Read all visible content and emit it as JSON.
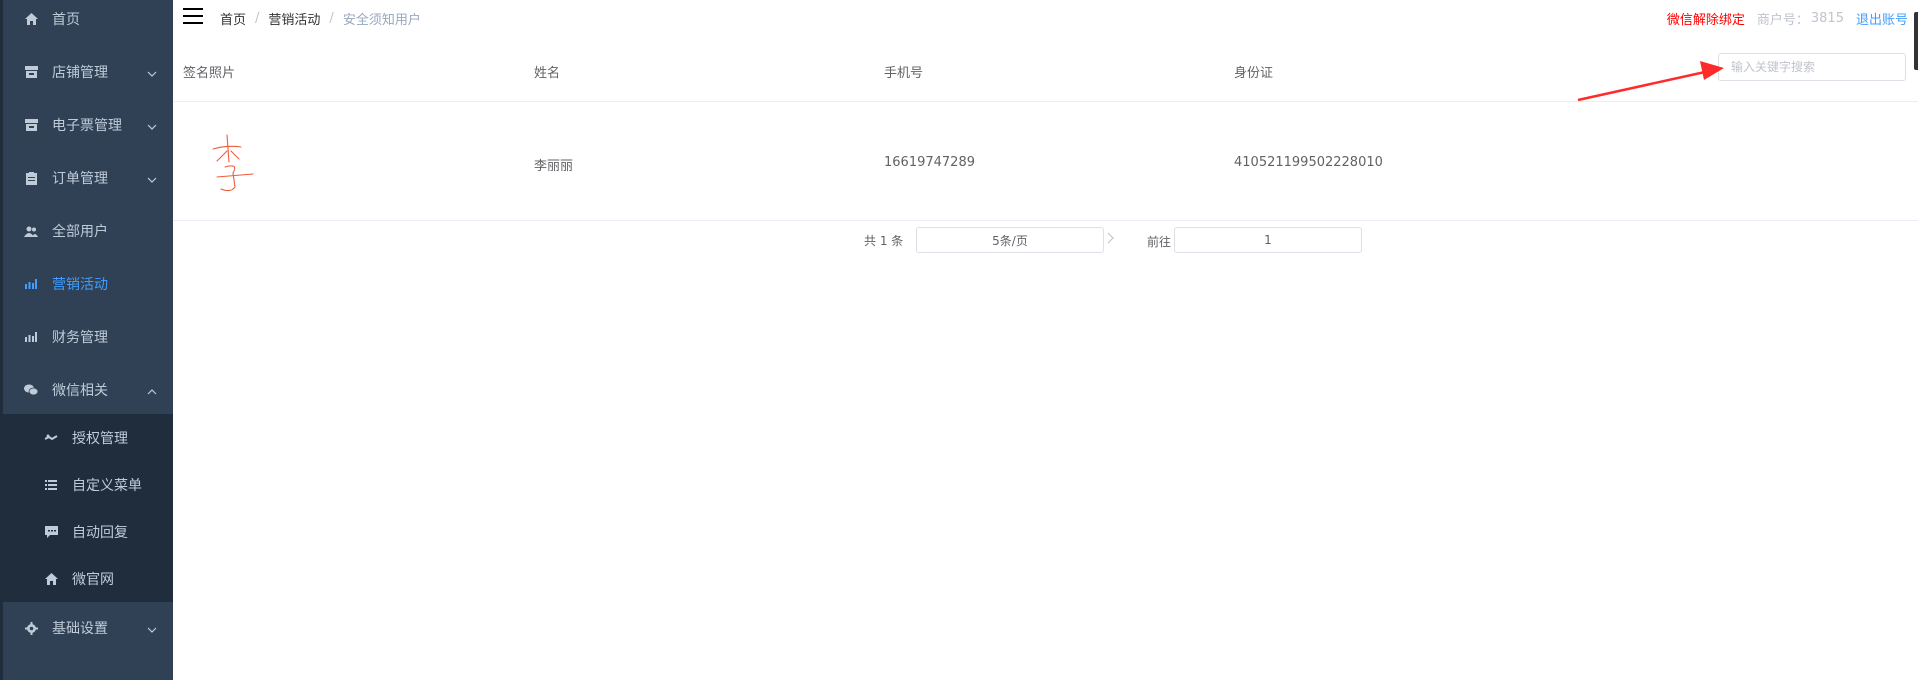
{
  "sidebar": {
    "items": [
      {
        "label": "首页",
        "icon": "home-icon"
      },
      {
        "label": "店铺管理",
        "icon": "store-icon"
      },
      {
        "label": "电子票管理",
        "icon": "ticket-icon"
      },
      {
        "label": "订单管理",
        "icon": "clipboard-icon"
      },
      {
        "label": "全部用户",
        "icon": "users-icon"
      },
      {
        "label": "营销活动",
        "icon": "bar-chart-icon",
        "active": true
      },
      {
        "label": "财务管理",
        "icon": "bar-chart-icon"
      },
      {
        "label": "微信相关",
        "icon": "wechat-icon",
        "expanded": true
      },
      {
        "label": "基础设置",
        "icon": "gear-icon"
      }
    ],
    "wechat_submenu": [
      {
        "label": "授权管理",
        "icon": "link-icon"
      },
      {
        "label": "自定义菜单",
        "icon": "list-icon"
      },
      {
        "label": "自动回复",
        "icon": "chat-icon"
      },
      {
        "label": "微官网",
        "icon": "home-icon"
      }
    ],
    "colors": {
      "background": "#304156",
      "submenu_background": "#1f2d3d",
      "text": "#bfcbd9",
      "active": "#409eff"
    }
  },
  "header": {
    "breadcrumb": [
      "首页",
      "营销活动",
      "安全须知用户"
    ],
    "breadcrumb_separator": "/",
    "unbind_wechat": "微信解除绑定",
    "merchant_label": "商户号：",
    "merchant_no": "3815",
    "logout": "退出账号"
  },
  "table": {
    "columns": [
      "签名照片",
      "姓名",
      "手机号",
      "身份证"
    ],
    "search_placeholder": "输入关键字搜索",
    "rows": [
      {
        "signature": "李",
        "name": "李丽丽",
        "phone": "16619747289",
        "id_card": "410521199502228010"
      }
    ]
  },
  "pagination": {
    "total": "共 1 条",
    "page_size": "5条/页",
    "goto_label": "前往",
    "current_page": "1"
  },
  "annotation": {
    "arrow_color": "#ff2a2a"
  }
}
